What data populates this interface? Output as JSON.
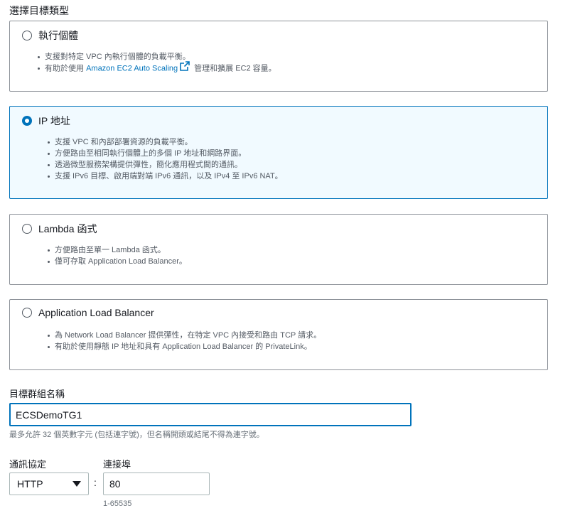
{
  "target_type": {
    "label": "選擇目標類型",
    "options": [
      {
        "title": "執行個體",
        "selected": false,
        "bullets": [
          "支援對特定 VPC 內執行個體的負載平衡。"
        ],
        "bullet_link": {
          "prefix": "有助於使用 ",
          "link": "Amazon EC2 Auto Scaling",
          "suffix": " 管理和擴展 EC2 容量。"
        }
      },
      {
        "title": "IP 地址",
        "selected": true,
        "bullets": [
          "支援 VPC 和內部部署資源的負載平衡。",
          "方便路由至相同執行個體上的多個 IP 地址和網路界面。",
          "透過微型服務架構提供彈性，簡化應用程式間的通訊。",
          "支援 IPv6 目標、啟用端對端 IPv6 通訊，以及 IPv4 至 IPv6 NAT。"
        ]
      },
      {
        "title": "Lambda 函式",
        "selected": false,
        "bullets": [
          "方便路由至單一 Lambda 函式。",
          "僅可存取 Application Load Balancer。"
        ]
      },
      {
        "title": "Application Load Balancer",
        "selected": false,
        "bullets": [
          "為 Network Load Balancer 提供彈性，在特定 VPC 內接受和路由 TCP 請求。",
          "有助於使用靜態 IP 地址和具有 Application Load Balancer 的 PrivateLink。"
        ]
      }
    ]
  },
  "target_group_name": {
    "label": "目標群組名稱",
    "value": "ECSDemoTG1",
    "hint": "最多允許 32 個英數字元 (包括連字號)，但名稱開頭或結尾不得為連字號。"
  },
  "protocol": {
    "label": "通訊協定",
    "value": "HTTP"
  },
  "port": {
    "label": "連接埠",
    "value": "80",
    "hint": "1-65535"
  },
  "colon": ":",
  "colors": {
    "accent": "#0073bb",
    "selected_bg": "#f1faff",
    "border": "#8d9299"
  }
}
